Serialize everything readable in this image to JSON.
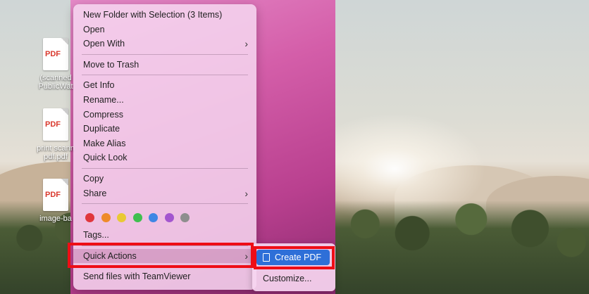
{
  "desktop": {
    "icons": [
      {
        "badge": "PDF",
        "label": "(scanned\nPublicWat"
      },
      {
        "badge": "PDF",
        "label": "print scann\npdf.pdf"
      },
      {
        "badge": "PDF",
        "label": "image-ba"
      }
    ]
  },
  "context_menu": {
    "group1": [
      "New Folder with Selection (3 Items)",
      "Open",
      "Open With"
    ],
    "group2": [
      "Move to Trash"
    ],
    "group3": [
      "Get Info",
      "Rename...",
      "Compress",
      "Duplicate",
      "Make Alias",
      "Quick Look"
    ],
    "group4": [
      "Copy",
      "Share"
    ],
    "tag_colors": [
      "#e0363c",
      "#ee8a2a",
      "#e9c934",
      "#3fbf4f",
      "#3f86e4",
      "#a356cf",
      "#8e8e8e"
    ],
    "tags_label": "Tags...",
    "quick_actions": "Quick Actions",
    "teamviewer": "Send files with TeamViewer"
  },
  "submenu": {
    "create_pdf": "Create PDF",
    "customize": "Customize..."
  }
}
